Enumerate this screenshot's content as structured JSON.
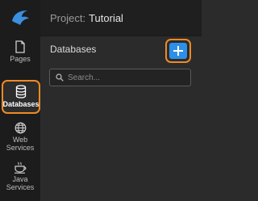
{
  "header": {
    "project_prefix": "Project:",
    "project_name": "Tutorial"
  },
  "sidebar": {
    "items": [
      {
        "label": "Pages",
        "icon": "page-icon"
      },
      {
        "label": "Databases",
        "icon": "database-icon",
        "active": true
      },
      {
        "label": "Web\nServices",
        "icon": "globe-icon"
      },
      {
        "label": "Java\nServices",
        "icon": "coffee-cup-icon"
      }
    ]
  },
  "panel": {
    "title": "Databases",
    "add_button_icon": "plus-icon",
    "search_placeholder": "Search..."
  },
  "colors": {
    "accent_highlight": "#f08a24",
    "primary_button": "#2e8fe8",
    "logo": "#3b8fe0"
  }
}
